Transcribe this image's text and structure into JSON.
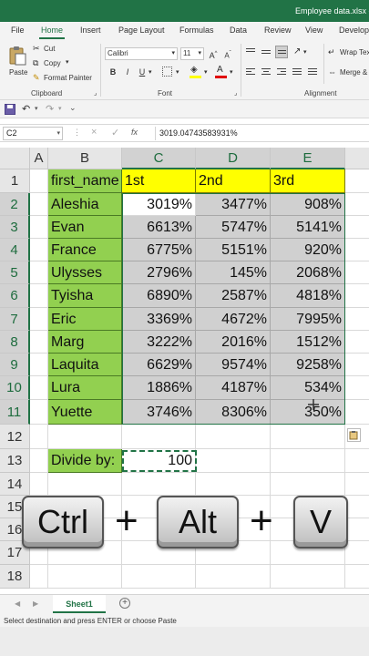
{
  "window": {
    "title": "Employee data.xlsx  -  E"
  },
  "menu": {
    "tabs": [
      "File",
      "Home",
      "Insert",
      "Page Layout",
      "Formulas",
      "Data",
      "Review",
      "View",
      "Develop"
    ]
  },
  "ribbon": {
    "clipboard": {
      "paste": "Paste",
      "cut": "Cut",
      "copy": "Copy",
      "format_painter": "Format Painter",
      "label": "Clipboard"
    },
    "font": {
      "font_name": "Calibri",
      "font_size": "11",
      "bold": "B",
      "italic": "I",
      "underline": "U",
      "label": "Font"
    },
    "alignment": {
      "wrap_text": "Wrap Tex",
      "merge": "Merge &",
      "label": "Alignment"
    }
  },
  "formula_bar": {
    "name_box": "C2",
    "formula": "3019.04743583931%"
  },
  "grid": {
    "columns": [
      "A",
      "B",
      "C",
      "D",
      "E"
    ],
    "rows": [
      "1",
      "2",
      "3",
      "4",
      "5",
      "6",
      "7",
      "8",
      "9",
      "10",
      "11",
      "12",
      "13",
      "14",
      "15",
      "16",
      "17",
      "18"
    ],
    "header": {
      "first_name": "first_name",
      "c": "1st",
      "d": "2nd",
      "e": "3rd"
    },
    "data": [
      {
        "name": "Aleshia",
        "c": "3019%",
        "d": "3477%",
        "e": "908%"
      },
      {
        "name": "Evan",
        "c": "6613%",
        "d": "5747%",
        "e": "5141%"
      },
      {
        "name": "France",
        "c": "6775%",
        "d": "5151%",
        "e": "920%"
      },
      {
        "name": "Ulysses",
        "c": "2796%",
        "d": "145%",
        "e": "2068%"
      },
      {
        "name": "Tyisha",
        "c": "6890%",
        "d": "2587%",
        "e": "4818%"
      },
      {
        "name": "Eric",
        "c": "3369%",
        "d": "4672%",
        "e": "7995%"
      },
      {
        "name": "Marg",
        "c": "3222%",
        "d": "2016%",
        "e": "1512%"
      },
      {
        "name": "Laquita",
        "c": "6629%",
        "d": "9574%",
        "e": "9258%"
      },
      {
        "name": "Lura",
        "c": "1886%",
        "d": "4187%",
        "e": "534%"
      },
      {
        "name": "Yuette",
        "c": "3746%",
        "d": "8306%",
        "e": "350%"
      }
    ],
    "divide_label": "Divide by:",
    "divide_value": "100"
  },
  "overlay_keys": {
    "ctrl": "Ctrl",
    "alt": "Alt",
    "v": "V",
    "plus": "+"
  },
  "sheets": {
    "active": "Sheet1"
  },
  "status": {
    "message": "Select destination and press ENTER or choose Paste"
  },
  "colors": {
    "accent": "#217346",
    "green_fill": "#92d050",
    "yellow_fill": "#ffff00",
    "gray_fill": "#d0d0d0"
  }
}
